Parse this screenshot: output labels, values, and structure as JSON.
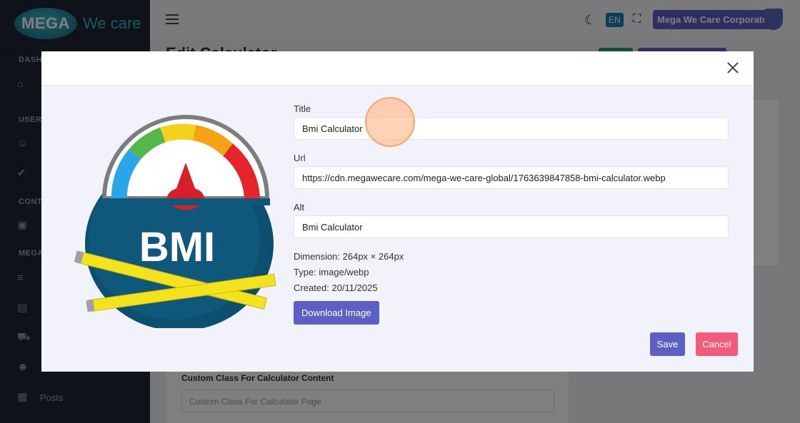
{
  "app": {
    "logo_text": "MEGA",
    "logo_tagline": "We care",
    "page_title": "Edit Calculator"
  },
  "sidebar": {
    "sections": [
      "DASH",
      "USER",
      "CONT",
      "MEGA"
    ],
    "bottom_item": "Posts"
  },
  "topbar": {
    "language": "EN",
    "account_label": "Mega We Care Corporate"
  },
  "background": {
    "field_label": "Custom Class For Calculator Content",
    "field_placeholder": "Custom Class For Calculator Page",
    "cancel_fragment": "cel"
  },
  "modal": {
    "image_text": "BMI",
    "title_label": "Title",
    "title_value": "Bmi Calculator",
    "url_label": "Url",
    "url_value": "https://cdn.megawecare.com/mega-we-care-global/1763639847858-bmi-calculator.webp",
    "alt_label": "Alt",
    "alt_value": "Bmi Calculator",
    "dimension": "Dimension: 264px × 264px",
    "type": "Type: image/webp",
    "created": "Created: 20/11/2025",
    "download_label": "Download Image",
    "save_label": "Save",
    "cancel_label": "Cancel"
  },
  "colors": {
    "primary": "#5d5fc4",
    "danger": "#f25c7a",
    "sidebar_bg": "#1e2430"
  }
}
